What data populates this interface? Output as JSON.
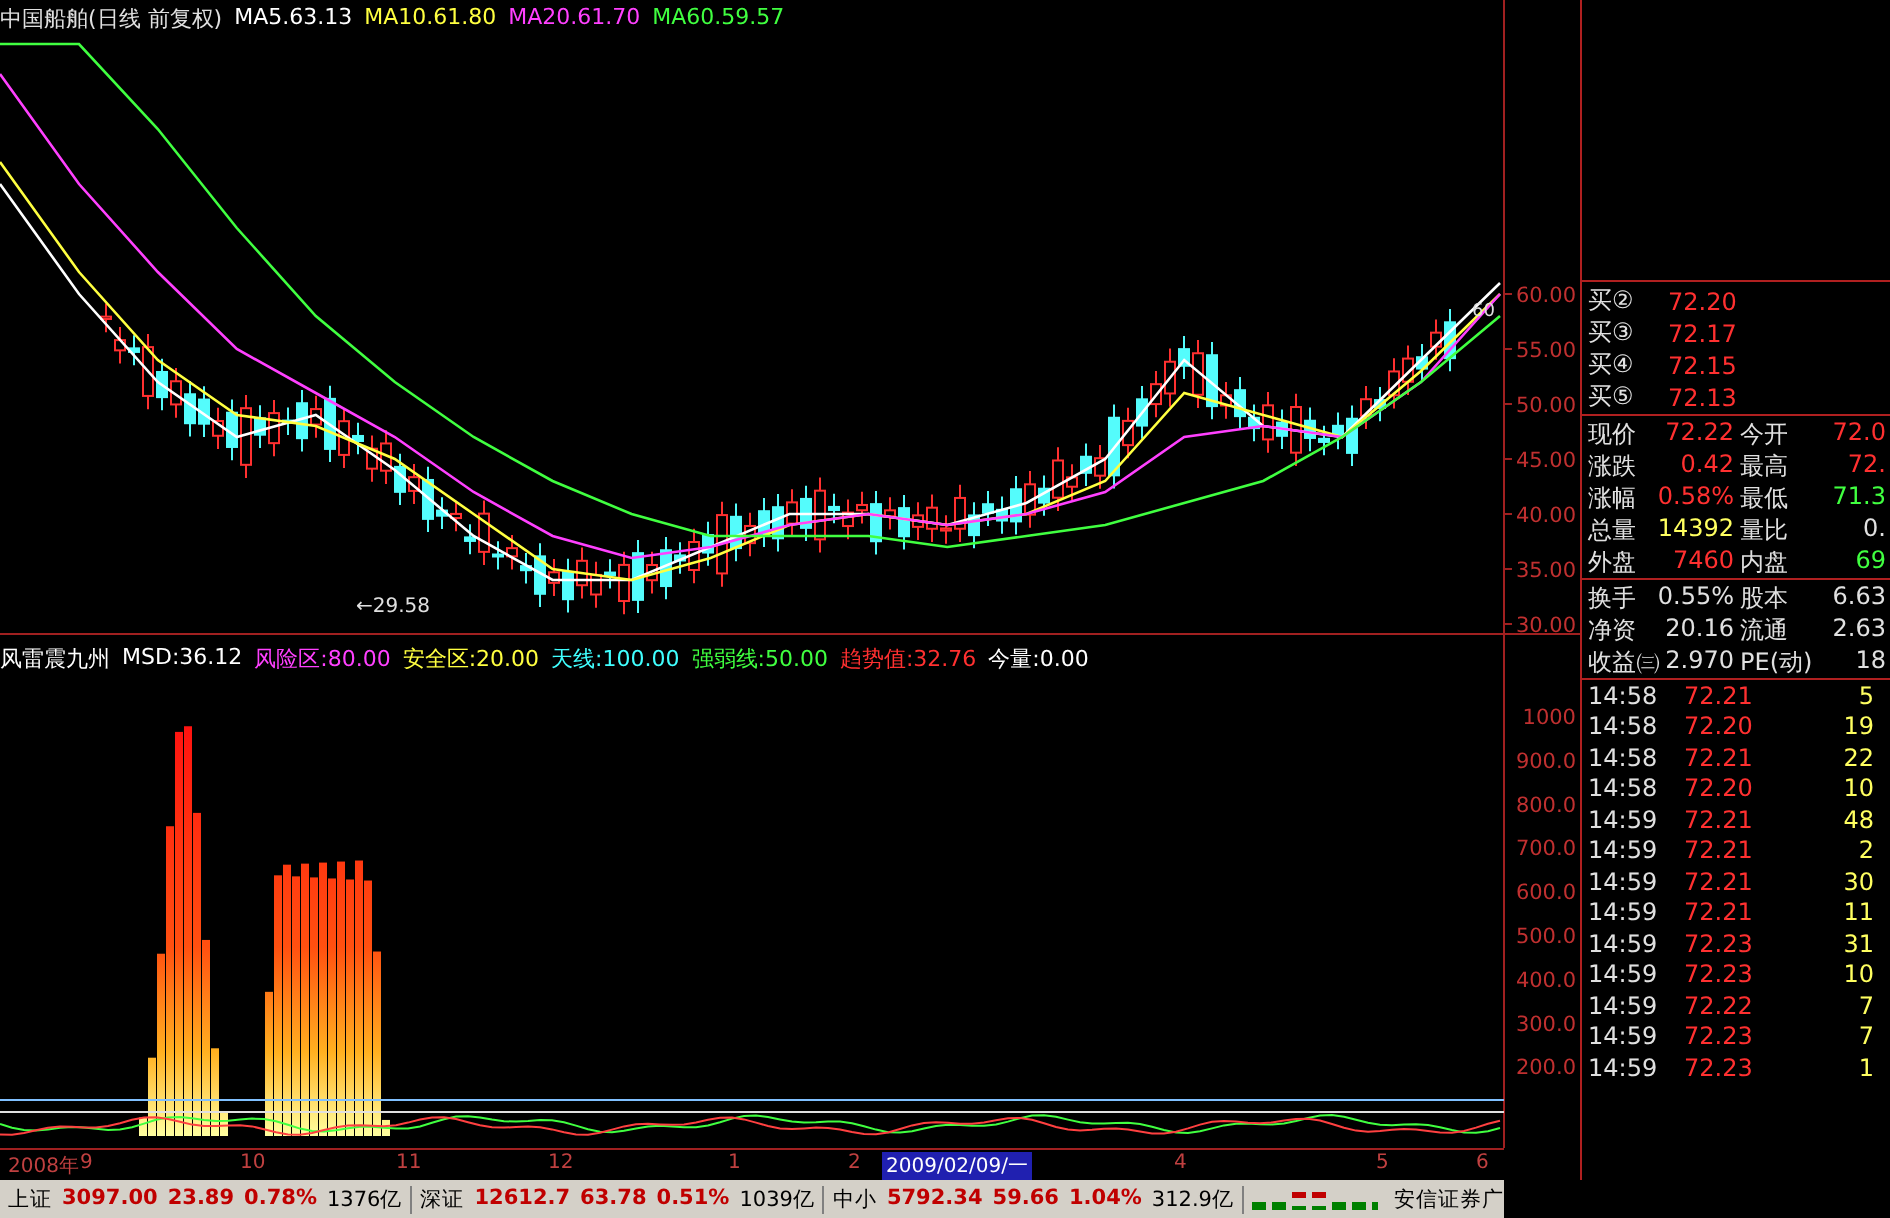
{
  "price_header": {
    "title": "中国船舶(日线 前复权)",
    "items": [
      {
        "text": "MA5.63.13",
        "color": "#ffffff"
      },
      {
        "text": "MA10.61.80",
        "color": "#ffff40"
      },
      {
        "text": "MA20.61.70",
        "color": "#ff40ff"
      },
      {
        "text": "MA60.59.57",
        "color": "#40ff40"
      }
    ]
  },
  "price_chart": {
    "ticks": [
      "60.00",
      "55.00",
      "50.00",
      "45.00",
      "40.00",
      "35.00",
      "30.00"
    ],
    "low_label": "←29.58",
    "high_label": "60"
  },
  "indicator": {
    "items": [
      {
        "text": "风雷震九州",
        "color": "#ffffff"
      },
      {
        "text": "MSD:36.12",
        "color": "#ffffff"
      },
      {
        "text": "风险区:80.00",
        "color": "#ff40ff"
      },
      {
        "text": "安全区:20.00",
        "color": "#ffff40"
      },
      {
        "text": "天线:100.00",
        "color": "#40ffff"
      },
      {
        "text": "强弱线:50.00",
        "color": "#40ff40"
      },
      {
        "text": "趋势值:32.76",
        "color": "#ff3030"
      },
      {
        "text": "今量:0.00",
        "color": "#ffffff"
      }
    ],
    "ticks": [
      "1000",
      "900.0",
      "800.0",
      "700.0",
      "600.0",
      "500.0",
      "400.0",
      "300.0",
      "200.0"
    ]
  },
  "time_axis": [
    {
      "label": "2008年",
      "selected": false
    },
    {
      "label": "9",
      "selected": false
    },
    {
      "label": "10",
      "selected": false
    },
    {
      "label": "11",
      "selected": false
    },
    {
      "label": "12",
      "selected": false
    },
    {
      "label": "1",
      "selected": false
    },
    {
      "label": "2",
      "selected": false
    },
    {
      "label": "2009/02/09/一",
      "selected": true
    },
    {
      "label": "4",
      "selected": false
    },
    {
      "label": "5",
      "selected": false
    },
    {
      "label": "6",
      "selected": false
    }
  ],
  "bids": [
    {
      "label": "买②",
      "price": "72.20"
    },
    {
      "label": "买③",
      "price": "72.17"
    },
    {
      "label": "买④",
      "price": "72.15"
    },
    {
      "label": "买⑤",
      "price": "72.13"
    }
  ],
  "quote": [
    {
      "label": "现价",
      "value": "72.22",
      "color": "#ff3030"
    },
    {
      "label": "今开",
      "value": "72.0",
      "color": "#ff3030"
    },
    {
      "label": "涨跌",
      "value": "0.42",
      "color": "#ff3030"
    },
    {
      "label": "最高",
      "value": "72.",
      "color": "#ff3030"
    },
    {
      "label": "涨幅",
      "value": "0.58%",
      "color": "#ff3030"
    },
    {
      "label": "最低",
      "value": "71.3",
      "color": "#40ff40"
    },
    {
      "label": "总量",
      "value": "14392",
      "color": "#ffff60"
    },
    {
      "label": "量比",
      "value": "0.",
      "color": "#e0e0e0"
    },
    {
      "label": "外盘",
      "value": "7460",
      "color": "#ff3030"
    },
    {
      "label": "内盘",
      "value": "69",
      "color": "#40ff40"
    }
  ],
  "stats": [
    {
      "label": "换手",
      "value": "0.55%"
    },
    {
      "label": "股本",
      "value": "6.63"
    },
    {
      "label": "净资",
      "value": "20.16"
    },
    {
      "label": "流通",
      "value": "2.63"
    },
    {
      "label": "收益㈢",
      "value": "2.970"
    },
    {
      "label": "PE(动)",
      "value": "18"
    }
  ],
  "trades": [
    {
      "time": "14:58",
      "price": "72.21",
      "volume": "5"
    },
    {
      "time": "14:58",
      "price": "72.20",
      "volume": "19"
    },
    {
      "time": "14:58",
      "price": "72.21",
      "volume": "22"
    },
    {
      "time": "14:58",
      "price": "72.20",
      "volume": "10"
    },
    {
      "time": "14:59",
      "price": "72.21",
      "volume": "48"
    },
    {
      "time": "14:59",
      "price": "72.21",
      "volume": "2"
    },
    {
      "time": "14:59",
      "price": "72.21",
      "volume": "30"
    },
    {
      "time": "14:59",
      "price": "72.21",
      "volume": "11"
    },
    {
      "time": "14:59",
      "price": "72.23",
      "volume": "31"
    },
    {
      "time": "14:59",
      "price": "72.23",
      "volume": "10"
    },
    {
      "time": "14:59",
      "price": "72.22",
      "volume": "7"
    },
    {
      "time": "14:59",
      "price": "72.23",
      "volume": "7"
    },
    {
      "time": "14:59",
      "price": "72.23",
      "volume": "1"
    }
  ],
  "status_bar": {
    "indices": [
      {
        "name": "上证",
        "value": "3097.00",
        "change": "23.89",
        "percent": "0.78%",
        "amount": "1376亿"
      },
      {
        "name": "深证",
        "value": "12612.7",
        "change": "63.78",
        "percent": "0.51%",
        "amount": "1039亿"
      },
      {
        "name": "中小",
        "value": "5792.34",
        "change": "59.66",
        "percent": "1.04%",
        "amount": "312.9亿"
      }
    ],
    "broker": "安信证券广"
  }
}
